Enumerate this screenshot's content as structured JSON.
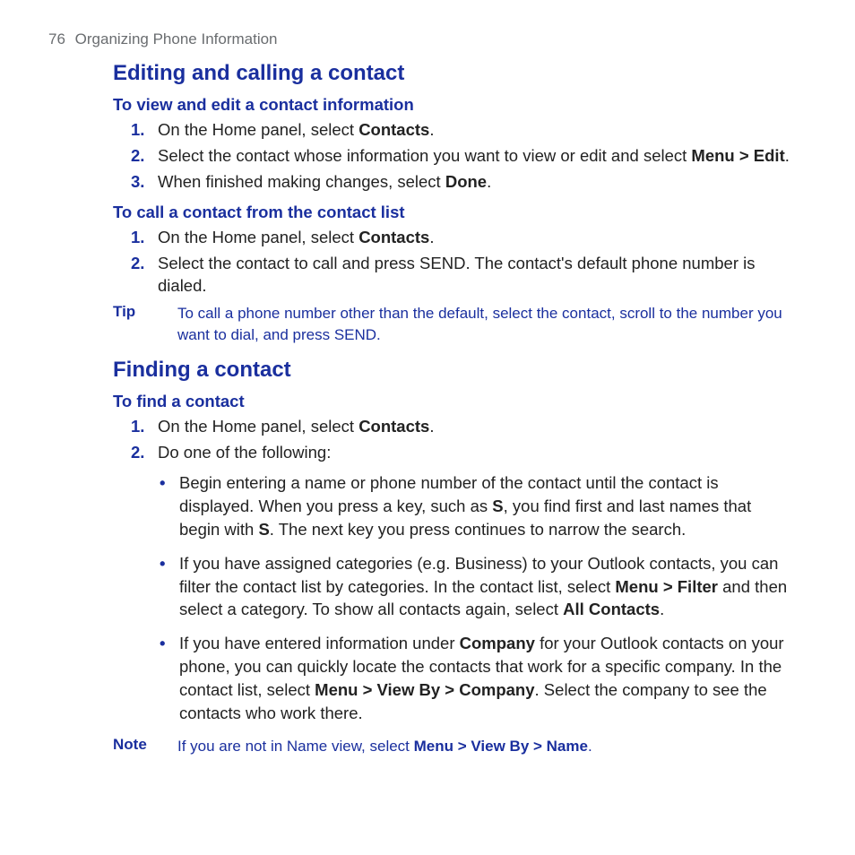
{
  "header": {
    "page_num": "76",
    "chapter": "Organizing Phone Information"
  },
  "s1": {
    "title": "Editing and calling a contact",
    "sub1": {
      "title": "To view and edit a contact information",
      "step1_a": "On the Home panel, select ",
      "step1_b": "Contacts",
      "step1_c": ".",
      "step2_a": "Select the contact whose information you want to view or edit and select ",
      "step2_b": "Menu > Edit",
      "step2_c": ".",
      "step3_a": "When finished making changes, select ",
      "step3_b": "Done",
      "step3_c": "."
    },
    "sub2": {
      "title": "To call a contact from the contact list",
      "step1_a": "On the Home panel, select ",
      "step1_b": "Contacts",
      "step1_c": ".",
      "step2": "Select the contact to call and press SEND. The contact's default phone number is dialed."
    },
    "tip": {
      "label": "Tip",
      "body": "To call a phone number other than the default, select the contact, scroll to the number you want to dial, and press SEND."
    }
  },
  "s2": {
    "title": "Finding a contact",
    "sub1": {
      "title": "To find a contact",
      "step1_a": "On the Home panel, select ",
      "step1_b": "Contacts",
      "step1_c": ".",
      "step2": "Do one of the following:",
      "b1_a": "Begin entering a name or phone number of the contact until the contact is displayed. When you press a key, such as ",
      "b1_b": "S",
      "b1_c": ", you find first and last names that begin with ",
      "b1_d": "S",
      "b1_e": ". The next key you press continues to narrow the search.",
      "b2_a": "If you have assigned categories (e.g. Business) to your Outlook contacts, you can filter the contact list by categories. In the contact list, select ",
      "b2_b": "Menu > Filter",
      "b2_c": " and then select a category. To show all contacts again, select ",
      "b2_d": "All Contacts",
      "b2_e": ".",
      "b3_a": "If you have entered information under ",
      "b3_b": "Company",
      "b3_c": " for your Outlook contacts on your phone, you can quickly locate the contacts that work for a specific company. In the contact list, select ",
      "b3_d": "Menu > View By > Company",
      "b3_e": ". Select the company to see the contacts who work there."
    },
    "note": {
      "label": "Note",
      "body_a": "If you are not in Name view, select ",
      "body_b": "Menu > View By > Name",
      "body_c": "."
    }
  }
}
